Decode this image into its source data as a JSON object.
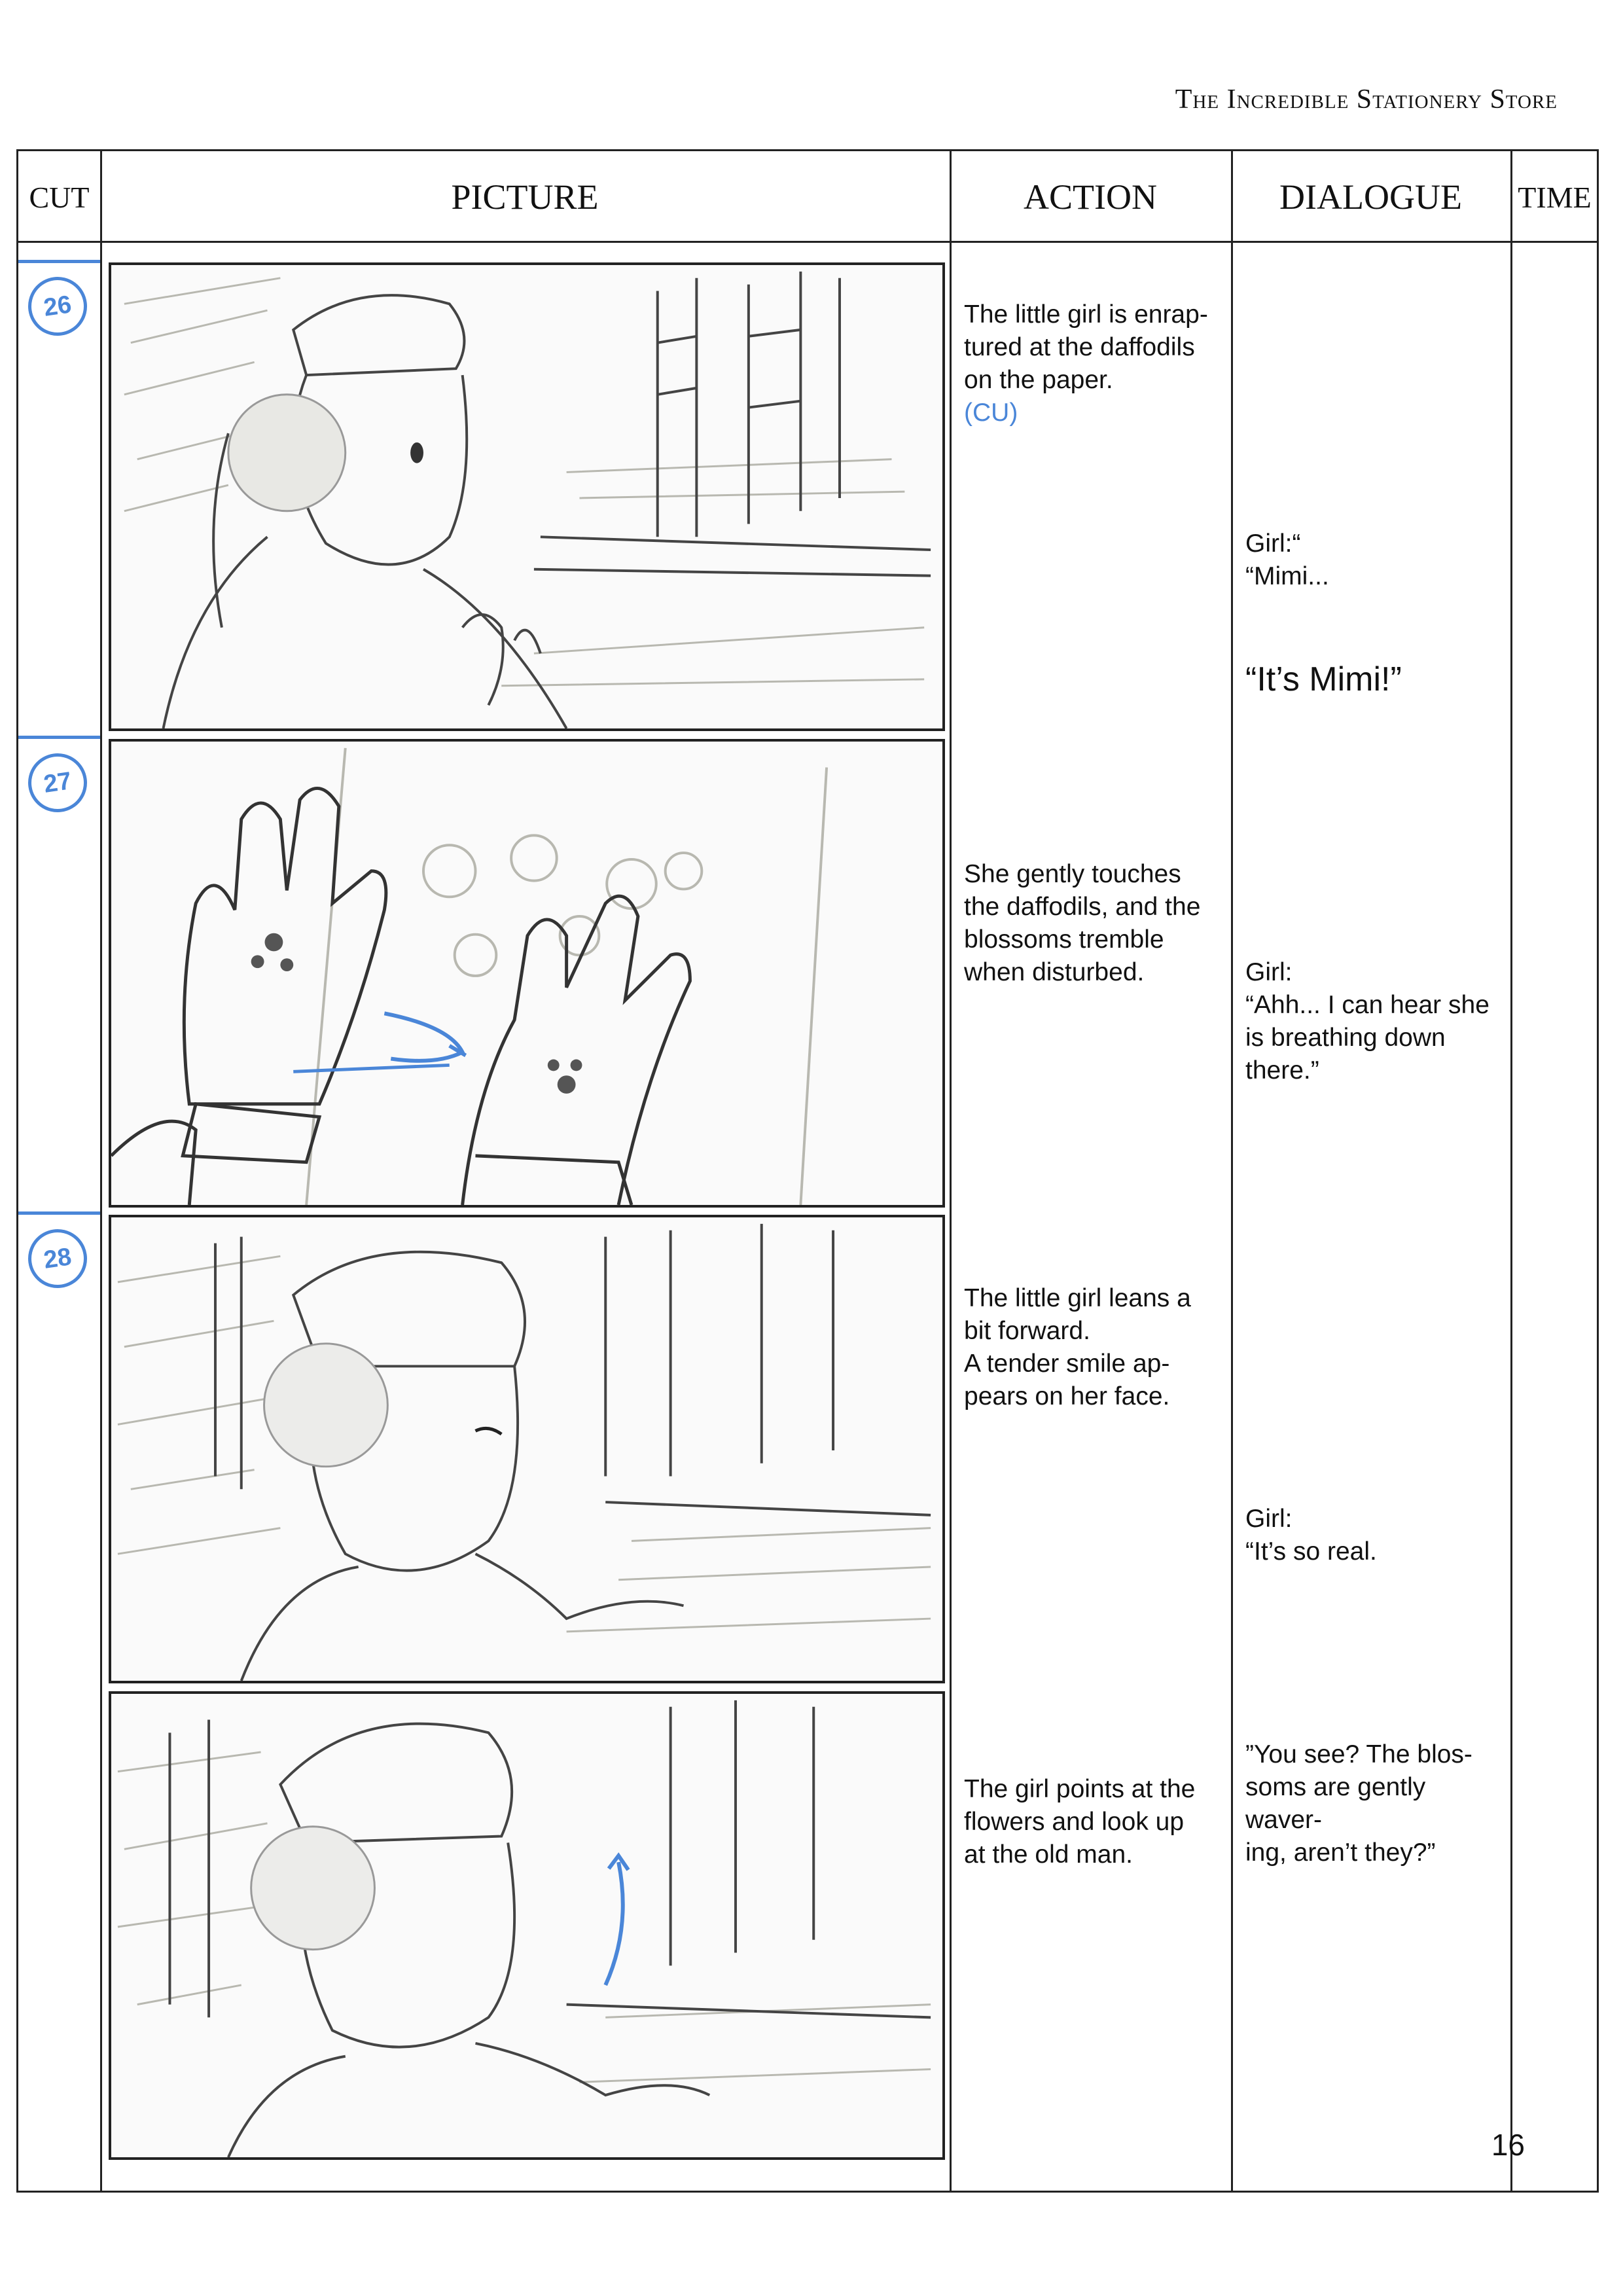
{
  "header": {
    "title": "The Incredible Stationery Store"
  },
  "columns": {
    "cut": "CUT",
    "picture": "PICTURE",
    "action": "ACTION",
    "dialogue": "DIALOGUE",
    "time": "TIME"
  },
  "cuts": [
    {
      "number": "26",
      "action": "The little girl is enrap-\ntured at the daffodils\non the paper.",
      "action_note": "(CU)",
      "dialogue": "Girl:“\n“Mimi...",
      "dialogue_emphasis": "“It’s Mimi!”"
    },
    {
      "number": "27",
      "action": "She gently touches\nthe daffodils, and the\nblossoms tremble\nwhen disturbed.",
      "dialogue": "Girl:\n“Ahh... I can hear she\nis breathing down\nthere.”"
    },
    {
      "number": "28",
      "action": "The little girl leans a\nbit forward.\nA tender smile ap-\npears on her face.",
      "dialogue": "Girl:\n“It’s so real."
    },
    {
      "number": "",
      "action": "The girl points at the\nflowers and look up\nat the old man.",
      "dialogue": "”You see? The blos-\nsoms are gently waver-\ning, aren’t they?”"
    }
  ],
  "page_number": "16",
  "colors": {
    "ink": "#222222",
    "annotation_blue": "#4a86d8",
    "pencil_gray": "#b8b8b0"
  }
}
